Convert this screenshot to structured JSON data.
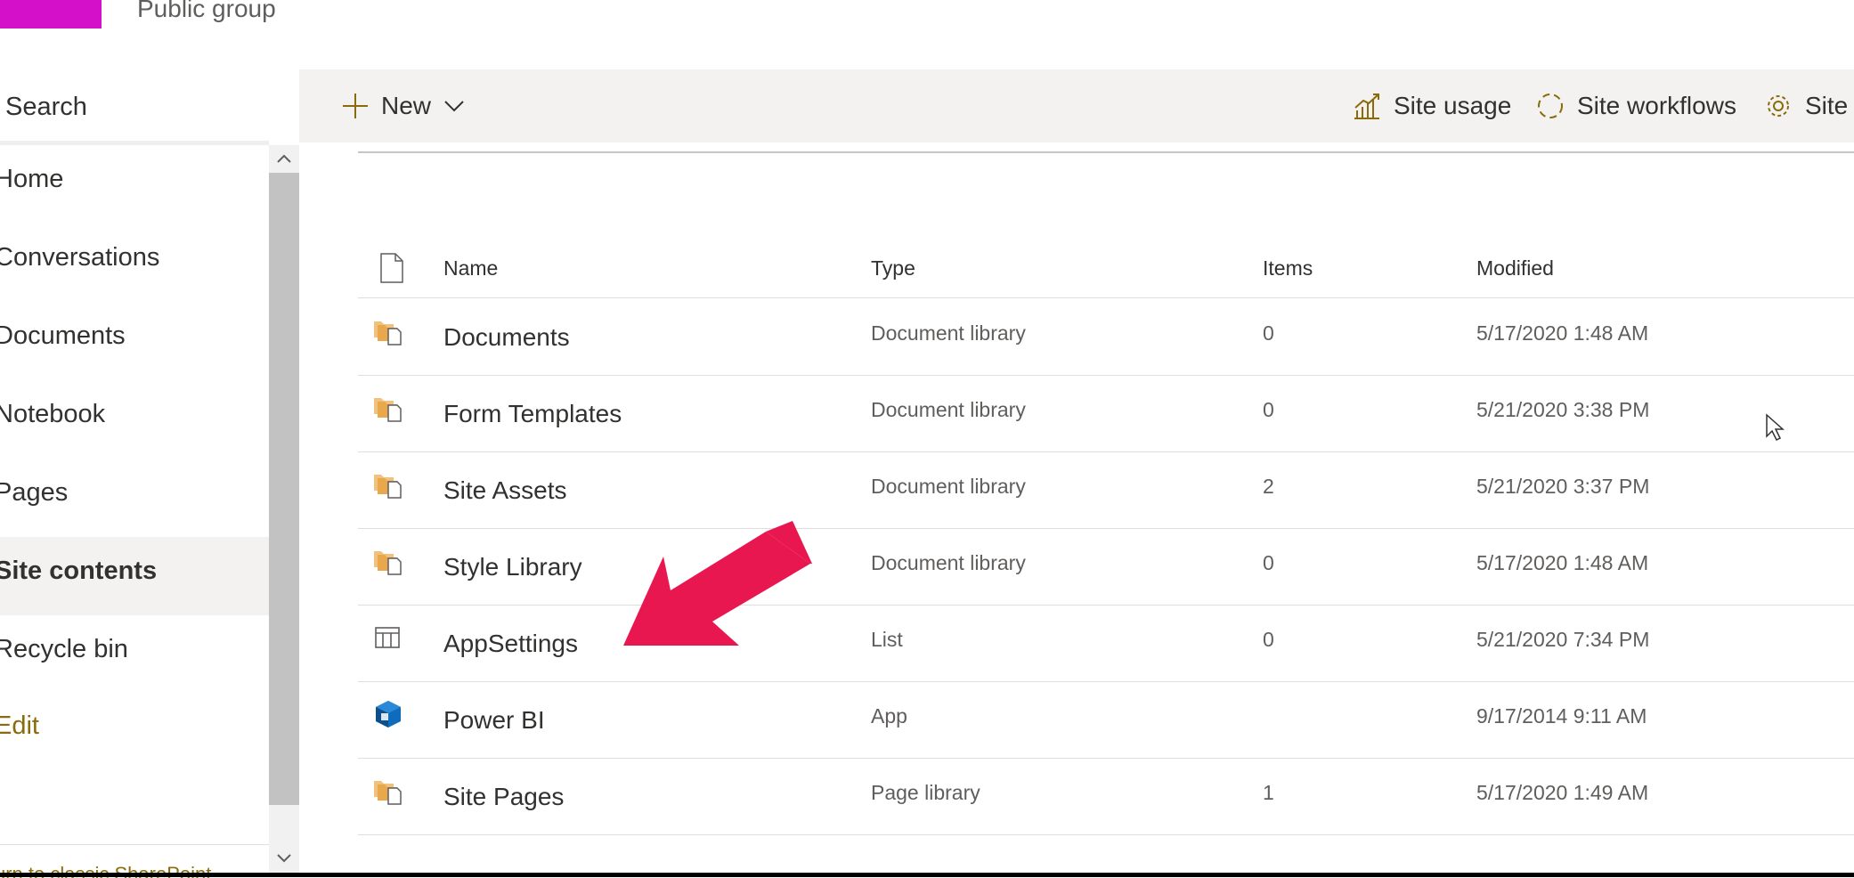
{
  "header": {
    "logo_color": "#d410c8",
    "group_type": "Public group"
  },
  "nav": {
    "search_label": "Search",
    "items": [
      {
        "label": "Home"
      },
      {
        "label": "Conversations"
      },
      {
        "label": "Documents"
      },
      {
        "label": "Notebook"
      },
      {
        "label": "Pages"
      },
      {
        "label": "Site contents",
        "selected": true
      },
      {
        "label": "Recycle bin"
      },
      {
        "label": "Edit"
      }
    ],
    "classic_link": "urn to classic SharePoint"
  },
  "command_bar": {
    "new_label": "New",
    "site_usage_label": "Site usage",
    "site_workflows_label": "Site workflows",
    "site_settings_label": "Site"
  },
  "list": {
    "columns": {
      "name": "Name",
      "type": "Type",
      "items": "Items",
      "modified": "Modified"
    },
    "rows": [
      {
        "icon": "document-library-icon",
        "name": "Documents",
        "type": "Document library",
        "items": "0",
        "modified": "5/17/2020 1:48 AM"
      },
      {
        "icon": "document-library-icon",
        "name": "Form Templates",
        "type": "Document library",
        "items": "0",
        "modified": "5/21/2020 3:38 PM"
      },
      {
        "icon": "document-library-icon",
        "name": "Site Assets",
        "type": "Document library",
        "items": "2",
        "modified": "5/21/2020 3:37 PM"
      },
      {
        "icon": "document-library-icon",
        "name": "Style Library",
        "type": "Document library",
        "items": "0",
        "modified": "5/17/2020 1:48 AM"
      },
      {
        "icon": "list-icon",
        "name": "AppSettings",
        "type": "List",
        "items": "0",
        "modified": "5/21/2020 7:34 PM"
      },
      {
        "icon": "power-bi-app-icon",
        "name": "Power BI",
        "type": "App",
        "items": "",
        "modified": "9/17/2014 9:11 AM"
      },
      {
        "icon": "page-library-icon",
        "name": "Site Pages",
        "type": "Page library",
        "items": "1",
        "modified": "5/17/2020 1:49 AM"
      }
    ]
  },
  "annotation": {
    "arrow_color": "#e8174f"
  }
}
